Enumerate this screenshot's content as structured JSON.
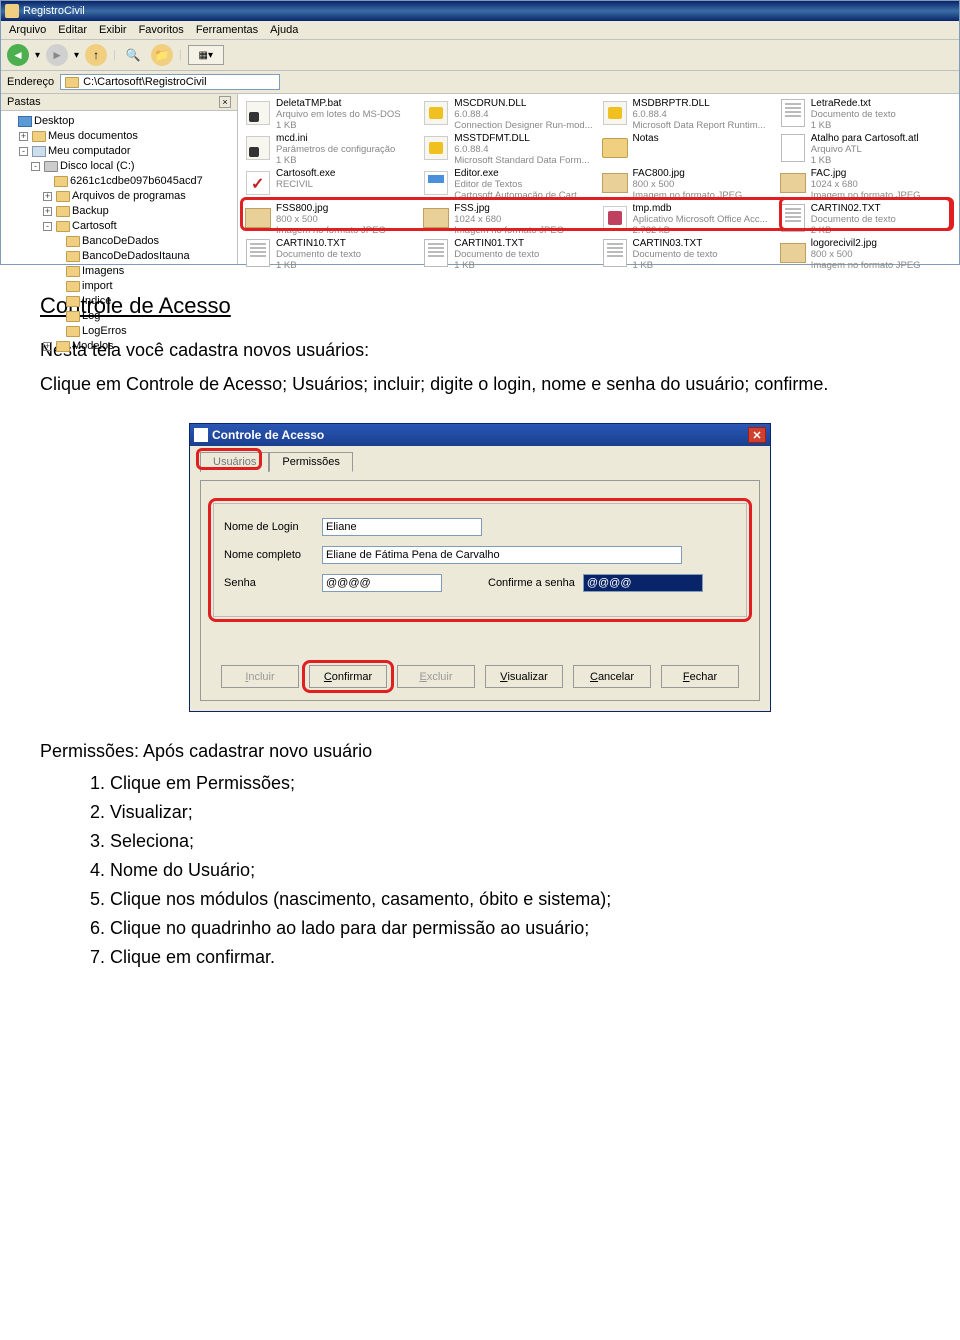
{
  "explorer": {
    "title": "RegistroCivil",
    "menus": [
      "Arquivo",
      "Editar",
      "Exibir",
      "Favoritos",
      "Ferramentas",
      "Ajuda"
    ],
    "address_label": "Endereço",
    "address_value": "C:\\Cartosoft\\RegistroCivil",
    "pastas_label": "Pastas",
    "tree": [
      {
        "ind": 0,
        "pm": "",
        "ic": "desk",
        "label": "Desktop"
      },
      {
        "ind": 1,
        "pm": "+",
        "ic": "folder",
        "label": "Meus documentos"
      },
      {
        "ind": 1,
        "pm": "-",
        "ic": "comp",
        "label": "Meu computador"
      },
      {
        "ind": 2,
        "pm": "-",
        "ic": "disk",
        "label": "Disco local (C:)"
      },
      {
        "ind": 3,
        "pm": "",
        "ic": "folder",
        "label": "6261c1cdbe097b6045acd7"
      },
      {
        "ind": 3,
        "pm": "+",
        "ic": "folder",
        "label": "Arquivos de programas"
      },
      {
        "ind": 3,
        "pm": "+",
        "ic": "folder",
        "label": "Backup"
      },
      {
        "ind": 3,
        "pm": "-",
        "ic": "folder",
        "label": "Cartosoft"
      },
      {
        "ind": 4,
        "pm": "",
        "ic": "folder",
        "label": "BancoDeDados"
      },
      {
        "ind": 4,
        "pm": "",
        "ic": "folder",
        "label": "BancoDeDadosItauna"
      },
      {
        "ind": 4,
        "pm": "",
        "ic": "folder",
        "label": "Imagens"
      },
      {
        "ind": 4,
        "pm": "",
        "ic": "folder",
        "label": "import"
      },
      {
        "ind": 4,
        "pm": "",
        "ic": "folder",
        "label": "Indice"
      },
      {
        "ind": 4,
        "pm": "",
        "ic": "folder",
        "label": "Log"
      },
      {
        "ind": 4,
        "pm": "",
        "ic": "folder",
        "label": "LogErros"
      },
      {
        "ind": 3,
        "pm": "+",
        "ic": "folder",
        "label": "Modelos"
      }
    ],
    "files": [
      {
        "ic": "bat",
        "name": "DeletaTMP.bat",
        "sub1": "Arquivo em lotes do MS-DOS",
        "sub2": "1 KB"
      },
      {
        "ic": "dll",
        "name": "MSCDRUN.DLL",
        "sub1": "6.0.88.4",
        "sub2": "Connection Designer Run-mod..."
      },
      {
        "ic": "dll",
        "name": "MSDBRPTR.DLL",
        "sub1": "6.0.88.4",
        "sub2": "Microsoft Data Report Runtim..."
      },
      {
        "ic": "txt",
        "name": "LetraRede.txt",
        "sub1": "Documento de texto",
        "sub2": "1 KB"
      },
      {
        "ic": "bat",
        "name": "mcd.ini",
        "sub1": "Parâmetros de configuração",
        "sub2": "1 KB"
      },
      {
        "ic": "dll",
        "name": "MSSTDFMT.DLL",
        "sub1": "6.0.88.4",
        "sub2": "Microsoft Standard Data Form..."
      },
      {
        "ic": "folder",
        "name": "Notas",
        "sub1": "",
        "sub2": ""
      },
      {
        "ic": "atl",
        "name": "Atalho para Cartosoft.atl",
        "sub1": "Arquivo ATL",
        "sub2": "1 KB"
      },
      {
        "ic": "exe",
        "name": "Cartosoft.exe",
        "sub1": "RECIVIL",
        "sub2": ""
      },
      {
        "ic": "exe2",
        "name": "Editor.exe",
        "sub1": "Editor de Textos",
        "sub2": "Cartosoft Automação de Cart..."
      },
      {
        "ic": "jpg",
        "name": "FAC800.jpg",
        "sub1": "800 x 500",
        "sub2": "Imagem no formato JPEG"
      },
      {
        "ic": "jpg",
        "name": "FAC.jpg",
        "sub1": "1024 x 680",
        "sub2": "Imagem no formato JPEG"
      },
      {
        "ic": "jpg",
        "name": "FSS800.jpg",
        "sub1": "800 x 500",
        "sub2": "Imagem no formato JPEG"
      },
      {
        "ic": "jpg",
        "name": "FSS.jpg",
        "sub1": "1024 x 680",
        "sub2": "Imagem no formato JPEG"
      },
      {
        "ic": "mdb",
        "name": "tmp.mdb",
        "sub1": "Aplicativo Microsoft Office Acc...",
        "sub2": "2.732 kB"
      },
      {
        "ic": "txt",
        "name": "CARTIN02.TXT",
        "sub1": "Documento de texto",
        "sub2": "2 KB"
      },
      {
        "ic": "txt",
        "name": "CARTIN10.TXT",
        "sub1": "Documento de texto",
        "sub2": "1 KB"
      },
      {
        "ic": "txt",
        "name": "CARTIN01.TXT",
        "sub1": "Documento de texto",
        "sub2": "1 KB"
      },
      {
        "ic": "txt",
        "name": "CARTIN03.TXT",
        "sub1": "Documento de texto",
        "sub2": "1 KB"
      },
      {
        "ic": "jpg",
        "name": "logorecivil2.jpg",
        "sub1": "800 x 500",
        "sub2": "Imagem no formato JPEG"
      }
    ]
  },
  "doc": {
    "heading": "Controle de Acesso",
    "p1": "Nesta tela você cadastra novos usuários:",
    "p2": "Clique em Controle de Acesso; Usuários; incluir; digite o login, nome e senha do usuário; confirme.",
    "p3": "Permissões: Após cadastrar novo usuário",
    "ol": [
      "Clique em Permissões;",
      "Visualizar;",
      "Seleciona;",
      "Nome do Usuário;",
      "Clique nos módulos (nascimento, casamento, óbito e sistema);",
      "Clique no quadrinho ao lado para dar permissão ao usuário;",
      "Clique em confirmar."
    ]
  },
  "dialog": {
    "title": "Controle de Acesso",
    "tabs": [
      "Usuários",
      "Permissões"
    ],
    "labels": {
      "login": "Nome de Login",
      "nome": "Nome completo",
      "senha": "Senha",
      "confirm": "Confirme a senha"
    },
    "values": {
      "login": "Eliane",
      "nome": "Eliane de Fátima Pena de Carvalho",
      "senha": "@@@@",
      "confirm": "@@@@"
    },
    "buttons": {
      "incluir": "Incluir",
      "confirmar": "Confirmar",
      "excluir": "Excluir",
      "visualizar": "Visualizar",
      "cancelar": "Cancelar",
      "fechar": "Fechar"
    }
  }
}
